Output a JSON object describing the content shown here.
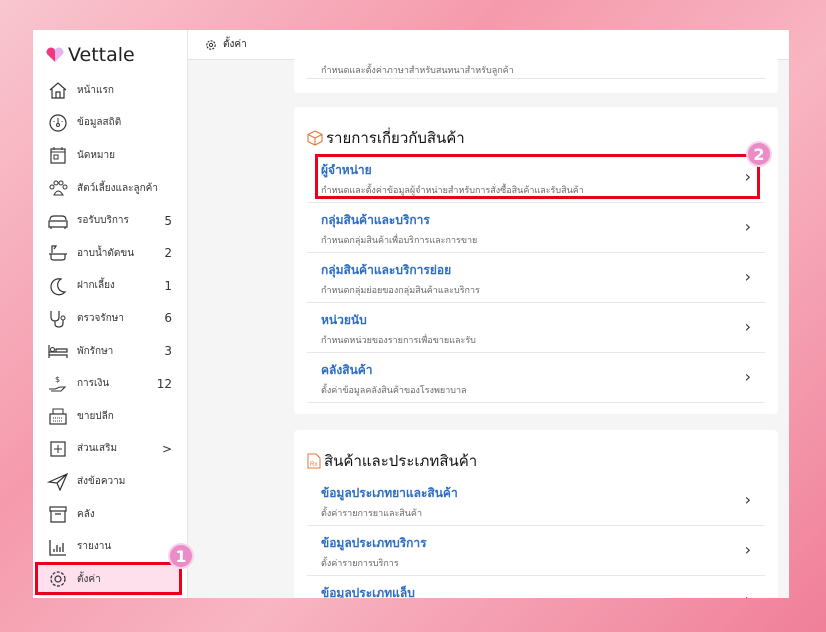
{
  "app": {
    "name": "Vettale"
  },
  "topbar": {
    "title": "ตั้งค่า"
  },
  "sidebar": {
    "items": [
      {
        "label": "หน้าแรก",
        "icon": "home-icon",
        "count": null
      },
      {
        "label": "ข้อมูลสถิติ",
        "icon": "dashboard-icon",
        "count": null
      },
      {
        "label": "นัดหมาย",
        "icon": "calendar-icon",
        "count": null
      },
      {
        "label": "สัตว์เลี้ยงและลูกค้า",
        "icon": "paw-icon",
        "count": null
      },
      {
        "label": "รอรับบริการ",
        "icon": "sofa-icon",
        "count": "5"
      },
      {
        "label": "อาบน้ำตัดขน",
        "icon": "bathtub-icon",
        "count": "2"
      },
      {
        "label": "ฝากเลี้ยง",
        "icon": "moon-icon",
        "count": "1"
      },
      {
        "label": "ตรวจรักษา",
        "icon": "stethoscope-icon",
        "count": "6"
      },
      {
        "label": "พักรักษา",
        "icon": "bed-icon",
        "count": "3"
      },
      {
        "label": "การเงิน",
        "icon": "money-hand-icon",
        "count": "12"
      },
      {
        "label": "ขายปลีก",
        "icon": "cash-register-icon",
        "count": null
      },
      {
        "label": "ส่วนเสริม",
        "icon": "plus-square-icon",
        "count": ">"
      },
      {
        "label": "ส่งข้อความ",
        "icon": "send-icon",
        "count": null
      },
      {
        "label": "คลัง",
        "icon": "archive-icon",
        "count": null
      },
      {
        "label": "รายงาน",
        "icon": "chart-icon",
        "count": null
      },
      {
        "label": "ตั้งค่า",
        "icon": "gear-icon",
        "count": null
      }
    ]
  },
  "main": {
    "partial_desc": "กำหนดและตั้งค่าภาษาสำหรับสนทนาสำหรับลูกค้า",
    "sections": [
      {
        "title": "รายการเกี่ยวกับสินค้า",
        "icon": "box-icon",
        "rows": [
          {
            "title": "ผู้จำหน่าย",
            "desc": "กำหนดและตั้งค่าข้อมูลผู้จำหน่ายสำหรับการสั่งซื้อสินค้าและรับสินค้า"
          },
          {
            "title": "กลุ่มสินค้าและบริการ",
            "desc": "กำหนดกลุ่มสินค้าเพื่อบริการและการขาย"
          },
          {
            "title": "กลุ่มสินค้าและบริการย่อย",
            "desc": "กำหนดกลุ่มย่อยของกลุ่มสินค้าและบริการ"
          },
          {
            "title": "หน่วยนับ",
            "desc": "กำหนดหน่วยของรายการเพื่อขายและรับ"
          },
          {
            "title": "คลังสินค้า",
            "desc": "ตั้งค่าข้อมูลคลังสินค้าของโรงพยาบาล"
          }
        ]
      },
      {
        "title": "สินค้าและประเภทสินค้า",
        "icon": "rx-file-icon",
        "rows": [
          {
            "title": "ข้อมูลประเภทยาและสินค้า",
            "desc": "ตั้งค่ารายการยาและสินค้า"
          },
          {
            "title": "ข้อมูลประเภทบริการ",
            "desc": "ตั้งค่ารายการบริการ"
          },
          {
            "title": "ข้อมูลประเภทแล็บ",
            "desc": ""
          }
        ]
      }
    ]
  },
  "annotations": {
    "step1": "1",
    "step2": "2"
  },
  "colors": {
    "accent": "#2b6cc4",
    "highlight": "#e8001c",
    "badge": "#e98cc7",
    "active_bg": "#fde0ec"
  }
}
